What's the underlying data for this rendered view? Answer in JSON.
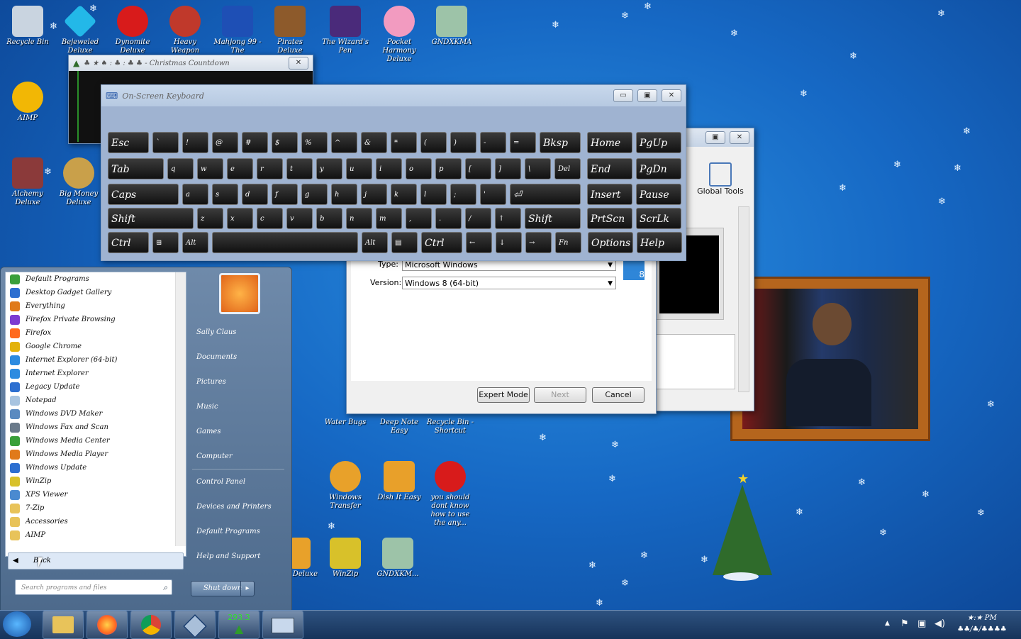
{
  "desktop_icons": [
    {
      "label": "Recycle Bin",
      "color": "#c9d4e0"
    },
    {
      "label": "Bejeweled Deluxe",
      "color": "#23b8e8"
    },
    {
      "label": "Dynomite Deluxe",
      "color": "#d81b1b"
    },
    {
      "label": "Heavy Weapon",
      "color": "#c0392b"
    },
    {
      "label": "Mahjong 99 - The",
      "color": "#1e4fb5"
    },
    {
      "label": "Pirates Deluxe",
      "color": "#8d5a2b"
    },
    {
      "label": "The Wizard's Pen",
      "color": "#4a2a7a"
    },
    {
      "label": "Pocket Harmony Deluxe",
      "color": "#f29bc0"
    },
    {
      "label": "GNDXKMA",
      "color": "#9dc3a8"
    },
    {
      "label": "AIMP",
      "color": "#f2b705"
    },
    {
      "label": "Alchemy Deluxe",
      "color": "#8b3a3a"
    },
    {
      "label": "Big Money Deluxe",
      "color": "#c9a04a"
    },
    {
      "label": "Water Bugs",
      "color": "#3aa0d8"
    },
    {
      "label": "Deep Note Easy",
      "color": "#2b6cc4"
    },
    {
      "label": "Recycle Bin - Shortcut",
      "color": "#c9d4e0"
    },
    {
      "label": "Windows Transfer",
      "color": "#e8a12a"
    },
    {
      "label": "Dish It Easy",
      "color": "#e8a02a"
    },
    {
      "label": "you should dont know how to use the any...",
      "color": "#d81b1b"
    },
    {
      "label": "WinZip",
      "color": "#d8c12a"
    },
    {
      "label": "GNDXKM...",
      "color": "#9dc3a8"
    },
    {
      "label": "Deluxe",
      "color": "#e8a12a"
    }
  ],
  "game_window": {
    "title": "♣ ★ ♠ : ♣ : ♣ ♣ - Christmas Countdown",
    "close": "✕"
  },
  "osk": {
    "title": "On-Screen Keyboard",
    "buttons": {
      "minimize": "▭",
      "restore": "▣",
      "close": "✕"
    },
    "rows": [
      [
        "Esc",
        "`",
        "!",
        "@",
        "#",
        "$",
        "%",
        "^",
        "&",
        "*",
        "(",
        ")",
        "-",
        "=",
        "Bksp",
        "Home",
        "PgUp"
      ],
      [
        "Tab",
        "q",
        "w",
        "e",
        "r",
        "t",
        "y",
        "u",
        "i",
        "o",
        "p",
        "[",
        "]",
        "\\",
        "Del",
        "End",
        "PgDn"
      ],
      [
        "Caps",
        "a",
        "s",
        "d",
        "f",
        "g",
        "h",
        "j",
        "k",
        "l",
        ";",
        "'",
        "⏎",
        "Insert",
        "Pause"
      ],
      [
        "Shift",
        "z",
        "x",
        "c",
        "v",
        "b",
        "n",
        "m",
        ",",
        ".",
        "/",
        "↑",
        "Shift",
        "PrtScn",
        "ScrLk"
      ],
      [
        "Ctrl",
        "⊞",
        "Alt",
        "",
        "Alt",
        "▤",
        "Ctrl",
        "←",
        "↓",
        "→",
        "Fn",
        "Options",
        "Help"
      ]
    ]
  },
  "vm_dialog": {
    "type_label": "Type:",
    "type_value": "Microsoft Windows",
    "version_label": "Version:",
    "version_value": "Windows 8 (64-bit)",
    "buttons": {
      "expert": "Expert Mode",
      "next": "Next",
      "cancel": "Cancel"
    }
  },
  "vbox_manager": {
    "global_tools": "Global Tools"
  },
  "start_menu": {
    "programs": [
      {
        "label": "Default Programs",
        "color": "#3a9f3a"
      },
      {
        "label": "Desktop Gadget Gallery",
        "color": "#2d6fd0"
      },
      {
        "label": "Everything",
        "color": "#e07a1a"
      },
      {
        "label": "Firefox Private Browsing",
        "color": "#7c3bd1"
      },
      {
        "label": "Firefox",
        "color": "#ff6a1f"
      },
      {
        "label": "Google Chrome",
        "color": "#e3b20b"
      },
      {
        "label": "Internet Explorer (64-bit)",
        "color": "#2c8be0"
      },
      {
        "label": "Internet Explorer",
        "color": "#2c8be0"
      },
      {
        "label": "Legacy Update",
        "color": "#2d6fd0"
      },
      {
        "label": "Notepad",
        "color": "#a8c4e0"
      },
      {
        "label": "Windows DVD Maker",
        "color": "#5a8ac0"
      },
      {
        "label": "Windows Fax and Scan",
        "color": "#6a7a8a"
      },
      {
        "label": "Windows Media Center",
        "color": "#3a9f3a"
      },
      {
        "label": "Windows Media Player",
        "color": "#e07a1a"
      },
      {
        "label": "Windows Update",
        "color": "#2d6fd0"
      },
      {
        "label": "WinZip",
        "color": "#d8c12a"
      },
      {
        "label": "XPS Viewer",
        "color": "#4a8ad0"
      },
      {
        "label": "7-Zip",
        "color": "#e8c35a"
      },
      {
        "label": "Accessories",
        "color": "#e8c35a"
      },
      {
        "label": "AIMP",
        "color": "#e8c35a"
      }
    ],
    "back_label": "Back",
    "search_placeholder": "Search programs and files",
    "right_items": [
      "Sally Claus",
      "Documents",
      "Pictures",
      "Music",
      "Games",
      "Computer",
      "Control Panel",
      "Devices and Printers",
      "Default Programs",
      "Help and Support"
    ],
    "shutdown_label": "Shut down"
  },
  "taskbar": {
    "counter": "293.3",
    "clock_time": "★:★ PM",
    "clock_date": "♣♣/♣/♣♣♣♣"
  },
  "colors": {
    "taskbar": "#1b3a66",
    "accent": "#2a8fe0"
  }
}
